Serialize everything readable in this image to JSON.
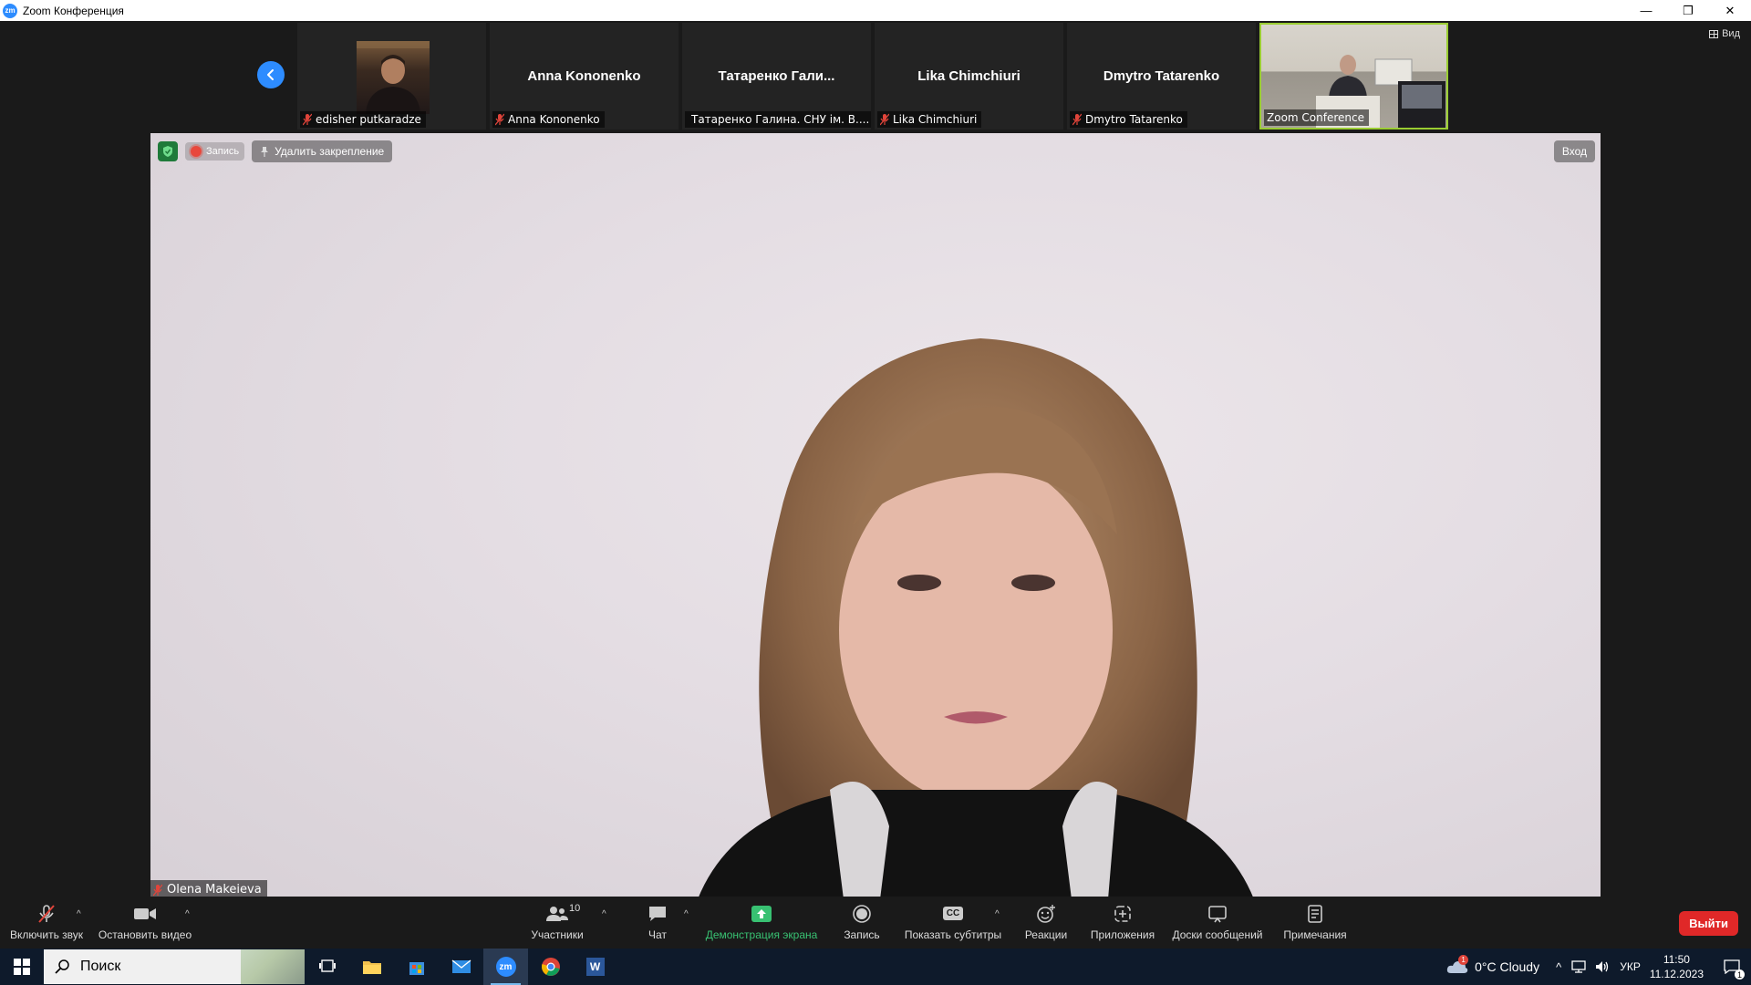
{
  "window": {
    "logo_text": "zm",
    "title": "Zoom Конференция",
    "controls": {
      "minimize": "—",
      "restore": "❐",
      "close": "✕"
    }
  },
  "meeting": {
    "view_label": "Вид",
    "participants_strip": [
      {
        "display_name": "",
        "label": "edisher putkaradze",
        "has_video": true
      },
      {
        "display_name": "Anna Kononenko",
        "label": "Anna Kononenko",
        "has_video": false
      },
      {
        "display_name": "Татаренко  Гали...",
        "label": "Татаренко Галина. СНУ ім. В....",
        "has_video": false
      },
      {
        "display_name": "Lika Chimchiuri",
        "label": "Lika Chimchiuri",
        "has_video": false
      },
      {
        "display_name": "Dmytro Tatarenko",
        "label": "Dmytro Tatarenko",
        "has_video": false
      },
      {
        "display_name": "",
        "label": "Zoom Conference",
        "has_video": true
      }
    ],
    "main_video": {
      "recording_label": "Запись",
      "unpin_label": "Удалить закрепление",
      "signin_label": "Вход",
      "speaker_name": "Olena Makeieva"
    }
  },
  "toolbar": {
    "unmute": "Включить звук",
    "stop_video": "Остановить видео",
    "participants": "Участники",
    "participants_count": "10",
    "chat": "Чат",
    "share_screen": "Демонстрация экрана",
    "record": "Запись",
    "captions": "Показать субтитры",
    "captions_icon_text": "CC",
    "reactions": "Реакции",
    "apps": "Приложения",
    "whiteboards": "Доски сообщений",
    "notes": "Примечания",
    "leave": "Выйти"
  },
  "taskbar": {
    "search_placeholder": "Поиск",
    "weather": "0°C  Cloudy",
    "weather_badge": "1",
    "language": "УКР",
    "time": "11:50",
    "date": "11.12.2023",
    "notification_count": "1",
    "zoom_icon_text": "zm",
    "word_icon_text": "W"
  },
  "colors": {
    "accent": "#2d8cff",
    "active_speaker_border": "#9acd32",
    "leave": "#e02828",
    "share": "#38c172",
    "muted": "#e0443a"
  }
}
